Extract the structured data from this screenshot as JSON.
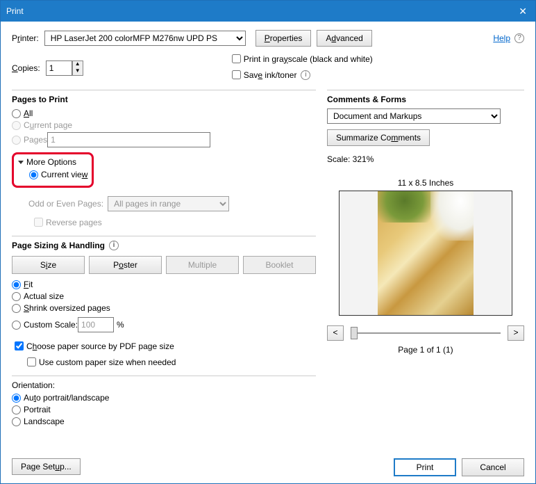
{
  "window": {
    "title": "Print"
  },
  "header": {
    "printer_label": "Printer:",
    "printer_value": "HP LaserJet 200 colorMFP M276nw UPD PS",
    "properties": "Properties",
    "advanced": "Advanced",
    "help": "Help",
    "copies_label": "Copies:",
    "copies_value": "1",
    "grayscale": "Print in grayscale (black and white)",
    "save_ink": "Save ink/toner"
  },
  "pages": {
    "title": "Pages to Print",
    "all": "All",
    "current": "Current page",
    "pages": "Pages",
    "pages_value": "1",
    "more_options": "More Options",
    "current_view": "Current view",
    "odd_even_label": "Odd or Even Pages:",
    "odd_even_value": "All pages in range",
    "reverse": "Reverse pages"
  },
  "sizing": {
    "title": "Page Sizing & Handling",
    "size": "Size",
    "poster": "Poster",
    "multiple": "Multiple",
    "booklet": "Booklet",
    "fit": "Fit",
    "actual": "Actual size",
    "shrink": "Shrink oversized pages",
    "custom_scale": "Custom Scale:",
    "custom_scale_value": "100",
    "percent": "%",
    "choose_paper": "Choose paper source by PDF page size",
    "use_custom": "Use custom paper size when needed"
  },
  "orientation": {
    "title": "Orientation:",
    "auto": "Auto portrait/landscape",
    "portrait": "Portrait",
    "landscape": "Landscape"
  },
  "comments": {
    "title": "Comments & Forms",
    "value": "Document and Markups",
    "summarize": "Summarize Comments"
  },
  "preview": {
    "scale": "Scale: 321%",
    "dimensions": "11 x 8.5 Inches",
    "page_info": "Page 1 of 1 (1)",
    "prev": "<",
    "next": ">"
  },
  "footer": {
    "page_setup": "Page Setup...",
    "print": "Print",
    "cancel": "Cancel"
  }
}
